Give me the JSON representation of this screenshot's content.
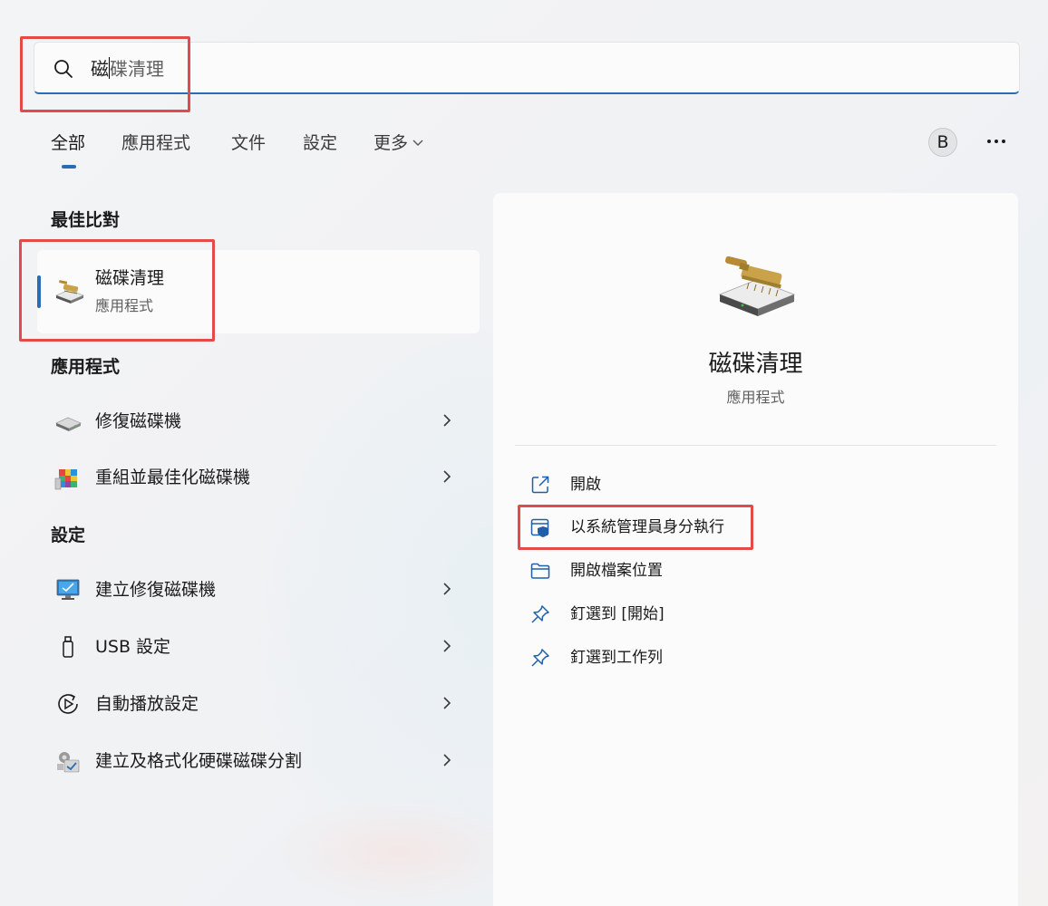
{
  "search": {
    "typed": "磁",
    "rest": "碟清理"
  },
  "tabs": [
    {
      "label": "全部"
    },
    {
      "label": "應用程式"
    },
    {
      "label": "文件"
    },
    {
      "label": "設定"
    },
    {
      "label": "更多"
    }
  ],
  "avatar_initial": "B",
  "best_match": {
    "heading": "最佳比對",
    "name": "磁碟清理",
    "type": "應用程式",
    "icon": "disk-cleanup-icon"
  },
  "apps": {
    "heading": "應用程式",
    "items": [
      {
        "label": "修復磁碟機",
        "icon": "drive-icon"
      },
      {
        "label": "重組並最佳化磁碟機",
        "icon": "defrag-icon"
      }
    ]
  },
  "settings": {
    "heading": "設定",
    "items": [
      {
        "label": "建立修復磁碟機",
        "icon": "recovery-drive-icon"
      },
      {
        "label": "USB 設定",
        "icon": "usb-icon"
      },
      {
        "label": "自動播放設定",
        "icon": "autoplay-icon"
      },
      {
        "label": "建立及格式化硬碟磁碟分割",
        "icon": "disk-management-icon"
      }
    ]
  },
  "preview": {
    "title": "磁碟清理",
    "subtitle": "應用程式",
    "actions": [
      {
        "label": "開啟",
        "icon": "open-external-icon"
      },
      {
        "label": "以系統管理員身分執行",
        "icon": "admin-shield-icon"
      },
      {
        "label": "開啟檔案位置",
        "icon": "folder-icon"
      },
      {
        "label": "釘選到 [開始]",
        "icon": "pin-icon"
      },
      {
        "label": "釘選到工作列",
        "icon": "pin-icon"
      }
    ]
  },
  "colors": {
    "accent": "#2a6db5",
    "highlight_box": "#e34a4a"
  }
}
